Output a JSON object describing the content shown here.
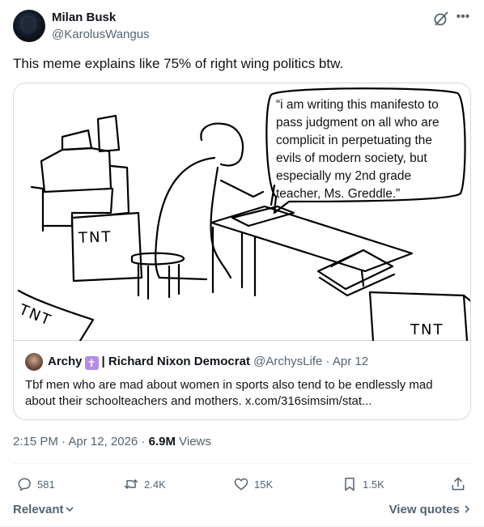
{
  "author": {
    "name": "Milan Busk",
    "handle": "@KarolusWangus"
  },
  "tweet": {
    "text": "This meme explains like 75% of right wing politics btw."
  },
  "meme": {
    "bubble_text": "“i am writing this manifesto to pass judgment on all who are complicit in perpetuating the evils of modern society, but especially my 2nd grade teacher, Ms. Greddle.”",
    "box_labels": [
      "TNT",
      "TNT",
      "TNT"
    ]
  },
  "quote": {
    "name": "Archy",
    "cross": "✝",
    "affiliation": "| Richard Nixon Democrat",
    "handle": "@ArchysLife",
    "dot": "·",
    "date": "Apr 12",
    "text": "Tbf men who are mad about women in sports also tend to be endlessly mad about their schoolteachers and mothers. x.com/316simsim/stat..."
  },
  "meta": {
    "time": "2:15 PM · Apr 12, 2026 · ",
    "views_count": "6.9M",
    "views_label": "Views"
  },
  "actions": {
    "replies": "581",
    "reposts": "2.4K",
    "likes": "15K",
    "bookmarks": "1.5K"
  },
  "footer": {
    "sort_label": "Relevant",
    "view_quotes": "View quotes"
  },
  "icons": {
    "grok": "grok-icon",
    "more": "more-icon",
    "reply": "reply-icon",
    "repost": "repost-icon",
    "like": "heart-icon",
    "bookmark": "bookmark-icon",
    "share": "share-icon"
  },
  "colors": {
    "text_primary": "#0f1419",
    "text_secondary": "#536471",
    "border": "#cfd9de",
    "cross_badge": "#b48ce6"
  }
}
